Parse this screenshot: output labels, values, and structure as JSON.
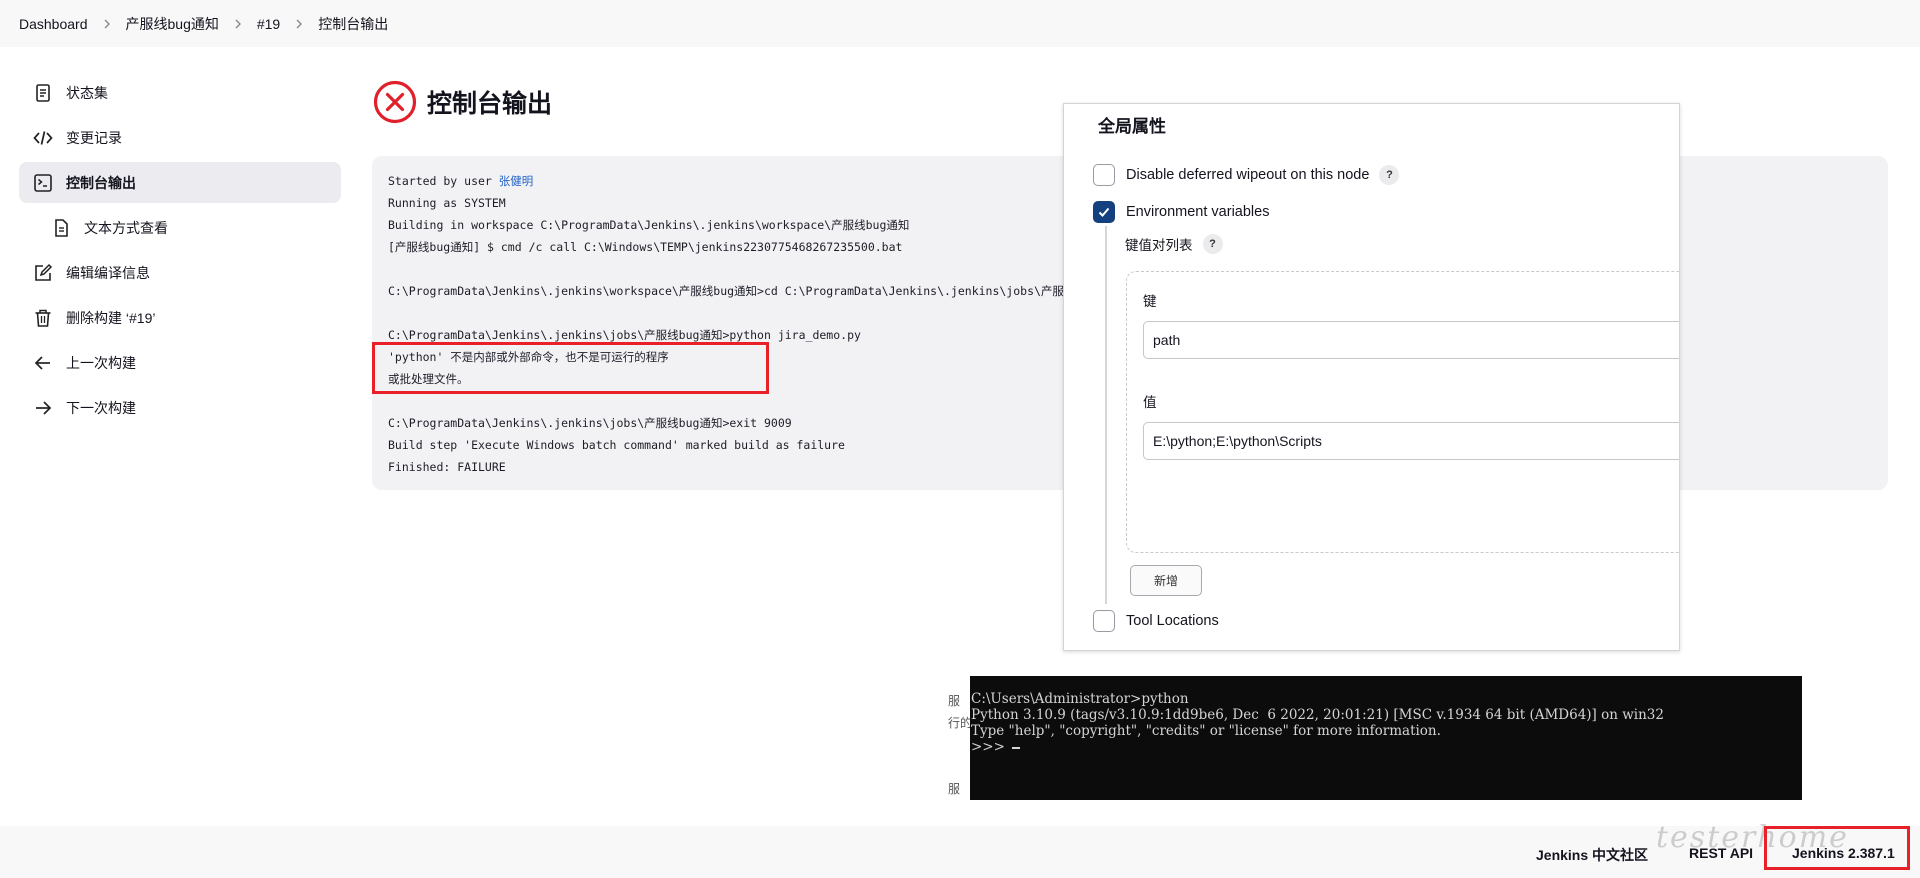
{
  "breadcrumb": [
    "Dashboard",
    "产服线bug通知",
    "#19",
    "控制台输出"
  ],
  "sidebar": {
    "items": [
      {
        "label": "状态集",
        "icon": "document-icon"
      },
      {
        "label": "变更记录",
        "icon": "code-icon"
      },
      {
        "label": "控制台输出",
        "icon": "terminal-icon",
        "active": true
      },
      {
        "label": "文本方式查看",
        "icon": "file-icon"
      },
      {
        "label": "编辑编译信息",
        "icon": "edit-icon"
      },
      {
        "label": "删除构建 ‘#19’",
        "icon": "trash-icon"
      },
      {
        "label": "上一次构建",
        "icon": "arrow-left-icon"
      },
      {
        "label": "下一次构建",
        "icon": "arrow-right-icon"
      }
    ]
  },
  "main": {
    "title": "控制台输出",
    "console": {
      "started_prefix": "Started by user ",
      "user": "张健明",
      "lines": [
        "Running as SYSTEM",
        "Building in workspace C:\\ProgramData\\Jenkins\\.jenkins\\workspace\\产服线bug通知",
        "[产服线bug通知] $ cmd /c call C:\\Windows\\TEMP\\jenkins2230775468267235500.bat",
        "",
        "C:\\ProgramData\\Jenkins\\.jenkins\\workspace\\产服线bug通知>cd C:\\ProgramData\\Jenkins\\.jenkins\\jobs\\产服线bug通知",
        "",
        "C:\\ProgramData\\Jenkins\\.jenkins\\jobs\\产服线bug通知>python jira_demo.py",
        "'python' 不是内部或外部命令，也不是可运行的程序",
        "或批处理文件。",
        "",
        "C:\\ProgramData\\Jenkins\\.jenkins\\jobs\\产服线bug通知>exit 9009",
        "Build step 'Execute Windows batch command' marked build as failure",
        "Finished: FAILURE"
      ]
    }
  },
  "panel": {
    "title": "全局属性",
    "options": [
      {
        "label": "Disable deferred wipeout on this node",
        "checked": false
      },
      {
        "label": "Environment variables",
        "checked": true
      },
      {
        "label": "Tool Locations",
        "checked": false
      }
    ],
    "kv_list_label": "键值对列表",
    "key_label": "键",
    "key_value": "path",
    "value_label": "值",
    "value_value": "E:\\python;E:\\python\\Scripts",
    "add_button": "新增",
    "help": "?"
  },
  "terminal": {
    "side_fragments": [
      "服",
      "行的",
      "服"
    ],
    "lines": [
      "C:\\Users\\Administrator>python",
      "Python 3.10.9 (tags/v3.10.9:1dd9be6, Dec  6 2022, 20:01:21) [MSC v.1934 64 bit (AMD64)] on win32",
      "Type \"help\", \"copyright\", \"credits\" or \"license\" for more information.",
      ">>> "
    ]
  },
  "footer": {
    "community": "Jenkins 中文社区",
    "rest_api": "REST API",
    "version": "Jenkins 2.387.1",
    "watermark": "testerhome"
  },
  "colors": {
    "fail": "#e0202a",
    "highlight_box": "#e8202a",
    "checkbox_on": "#15407f",
    "link": "#2563c6"
  }
}
